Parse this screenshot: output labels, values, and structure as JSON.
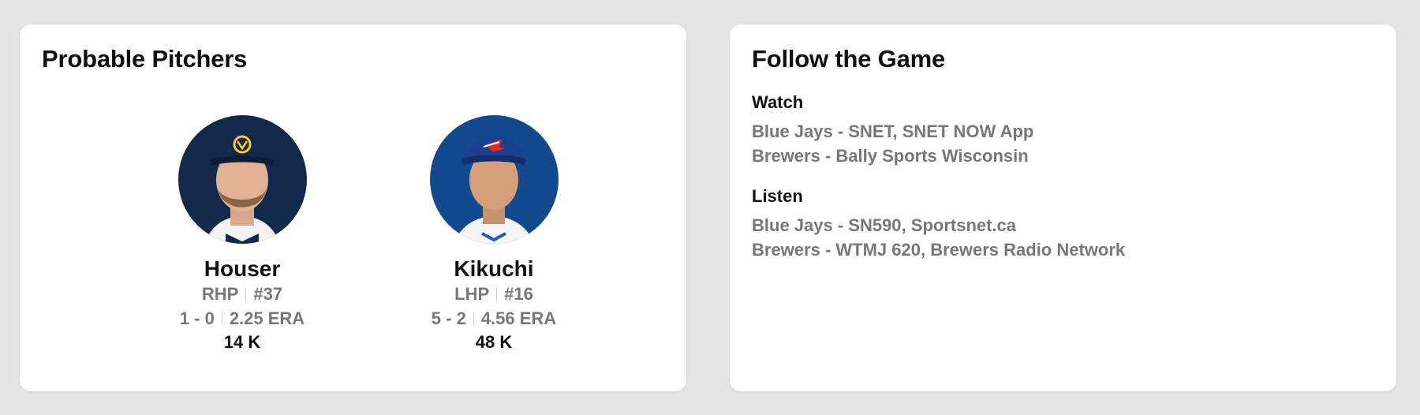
{
  "probable_pitchers": {
    "title": "Probable Pitchers",
    "pitchers": [
      {
        "name": "Houser",
        "throws": "RHP",
        "number": "#37",
        "record": "1 - 0",
        "era": "2.25 ERA",
        "strikeouts": "14 K",
        "cap_color": "#13294b"
      },
      {
        "name": "Kikuchi",
        "throws": "LHP",
        "number": "#16",
        "record": "5 - 2",
        "era": "4.56 ERA",
        "strikeouts": "48 K",
        "cap_color": "#134a8e"
      }
    ]
  },
  "follow_the_game": {
    "title": "Follow the Game",
    "watch": {
      "label": "Watch",
      "lines": [
        "Blue Jays - SNET, SNET NOW App",
        "Brewers - Bally Sports Wisconsin"
      ]
    },
    "listen": {
      "label": "Listen",
      "lines": [
        "Blue Jays - SN590, Sportsnet.ca",
        "Brewers - WTMJ 620, Brewers Radio Network"
      ]
    }
  }
}
